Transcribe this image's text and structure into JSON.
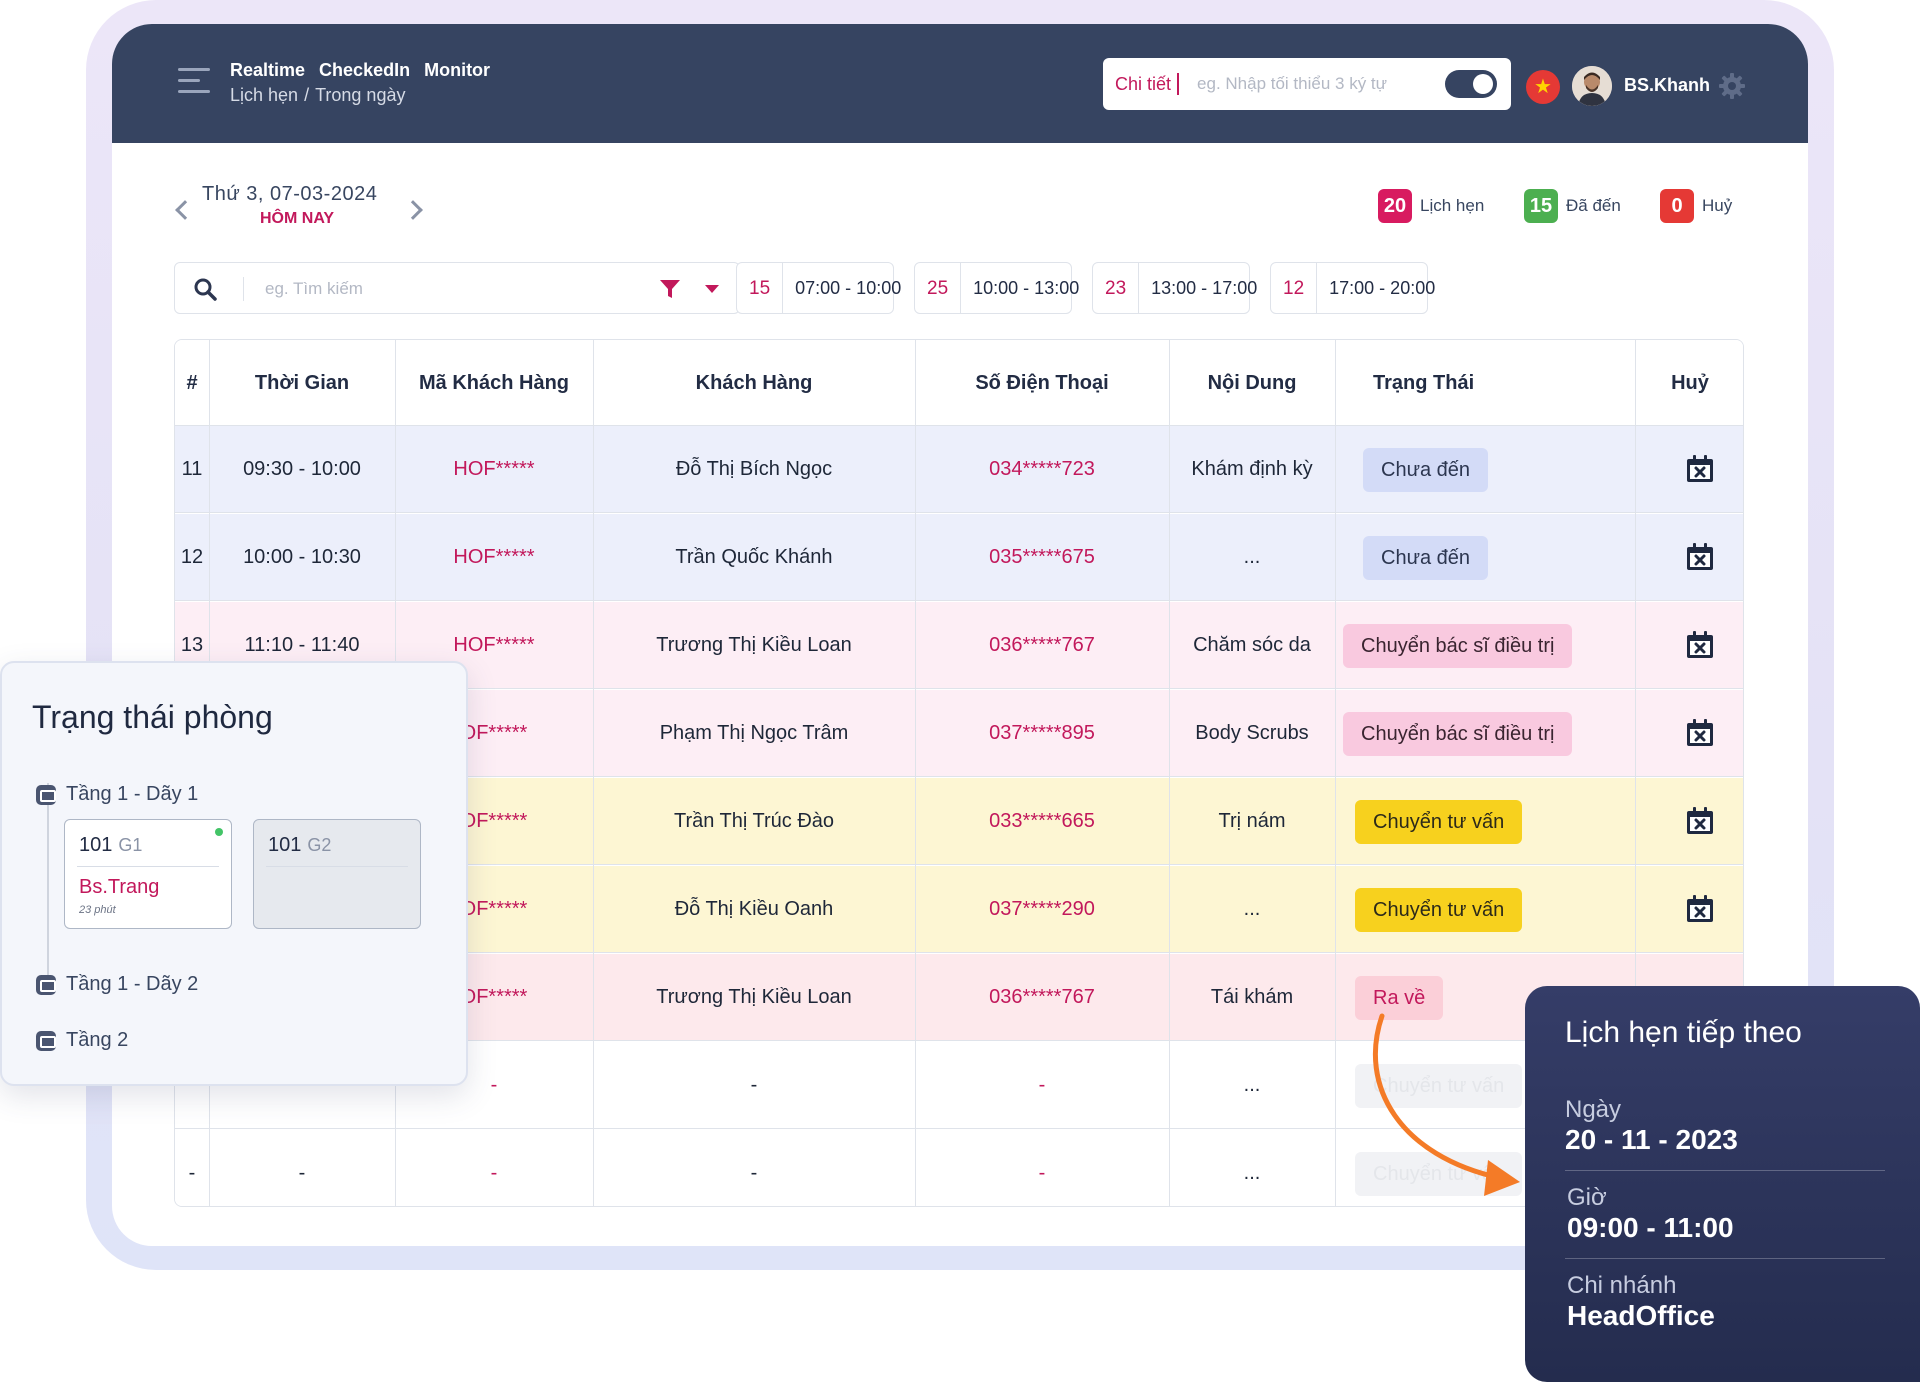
{
  "header": {
    "tabs": [
      "Realtime",
      "CheckedIn",
      "Monitor"
    ],
    "breadcrumb": [
      "Lịch hẹn",
      "/",
      "Trong ngày"
    ],
    "search_label": "Chi tiết",
    "search_placeholder": "eg. Nhập tối thiểu 3 ký tự",
    "flag_icon": "vietnam-flag-icon",
    "user_name": "BS.Khanh"
  },
  "date_nav": {
    "date": "Thứ 3, 07-03-2024",
    "today": "HÔM NAY"
  },
  "summary": [
    {
      "count": "20",
      "label": "Lịch hẹn",
      "color": "#d81b60"
    },
    {
      "count": "15",
      "label": "Đã đến",
      "color": "#4caf50"
    },
    {
      "count": "0",
      "label": "Huỷ",
      "color": "#e53935"
    }
  ],
  "filter": {
    "placeholder": "eg. Tìm kiếm"
  },
  "time_slots": [
    {
      "count": "15",
      "range": "07:00 - 10:00"
    },
    {
      "count": "25",
      "range": "10:00 - 13:00"
    },
    {
      "count": "23",
      "range": "13:00 - 17:00"
    },
    {
      "count": "12",
      "range": "17:00 - 20:00"
    }
  ],
  "table": {
    "columns": [
      "#",
      "Thời Gian",
      "Mã Khách Hàng",
      "Khách Hàng",
      "Số Điện Thoại",
      "Nội Dung",
      "Trạng Thái",
      "Huỷ"
    ],
    "rows": [
      {
        "no": "11",
        "time": "09:30 - 10:00",
        "code": "HOF*****",
        "name": "Đỗ Thị Bích Ngọc",
        "phone": "034*****723",
        "content": "Khám định kỳ",
        "status": "Chưa đến",
        "status_type": "pending"
      },
      {
        "no": "12",
        "time": "10:00 - 10:30",
        "code": "HOF*****",
        "name": "Trần Quốc Khánh",
        "phone": "035*****675",
        "content": "...",
        "status": "Chưa đến",
        "status_type": "pending"
      },
      {
        "no": "13",
        "time": "11:10 - 11:40",
        "code": "HOF*****",
        "name": "Trương Thị Kiều Loan",
        "phone": "036*****767",
        "content": "Chăm sóc da",
        "status": "Chuyển bác sĩ điều trị",
        "status_type": "doctor"
      },
      {
        "no": "",
        "time": "",
        "code": "OF*****",
        "name": "Phạm Thị Ngọc Trâm",
        "phone": "037*****895",
        "content": "Body Scrubs",
        "status": "Chuyển bác sĩ điều trị",
        "status_type": "doctor"
      },
      {
        "no": "",
        "time": "",
        "code": "OF*****",
        "name": "Trần Thị Trúc Đào",
        "phone": "033*****665",
        "content": "Trị nám",
        "status": "Chuyển tư vấn",
        "status_type": "consult"
      },
      {
        "no": "",
        "time": "",
        "code": "OF*****",
        "name": "Đỗ Thị Kiều Oanh",
        "phone": "037*****290",
        "content": "...",
        "status": "Chuyển tư vấn",
        "status_type": "consult"
      },
      {
        "no": "",
        "time": "",
        "code": "OF*****",
        "name": "Trương Thị Kiều Loan",
        "phone": "036*****767",
        "content": "Tái khám",
        "status": "Ra về",
        "status_type": "left"
      },
      {
        "no": "",
        "time": "",
        "code": "-",
        "name": "-",
        "phone": "-",
        "content": "...",
        "status": "Chuyển tư vấn",
        "status_type": "faded"
      },
      {
        "no": "-",
        "time": "-",
        "code": "-",
        "name": "-",
        "phone": "-",
        "content": "...",
        "status": "Chuyển tư vấn",
        "status_type": "faded"
      }
    ]
  },
  "room_status": {
    "title": "Trạng thái phòng",
    "floors": [
      "Tầng 1 - Dãy 1",
      "Tầng 1 - Dãy 2",
      "Tầng 2"
    ],
    "rooms": [
      {
        "number": "101",
        "group": "G1",
        "doctor": "Bs.Trang",
        "minutes": "23 phút",
        "active": true
      },
      {
        "number": "101",
        "group": "G2",
        "doctor": "",
        "minutes": "",
        "active": false
      }
    ]
  },
  "next_appointment": {
    "title": "Lịch hẹn tiếp theo",
    "date_label": "Ngày",
    "date_value": "20 - 11 - 2023",
    "time_label": "Giờ",
    "time_value": "09:00 - 11:00",
    "branch_label": "Chi nhánh",
    "branch_value": "HeadOffice"
  }
}
